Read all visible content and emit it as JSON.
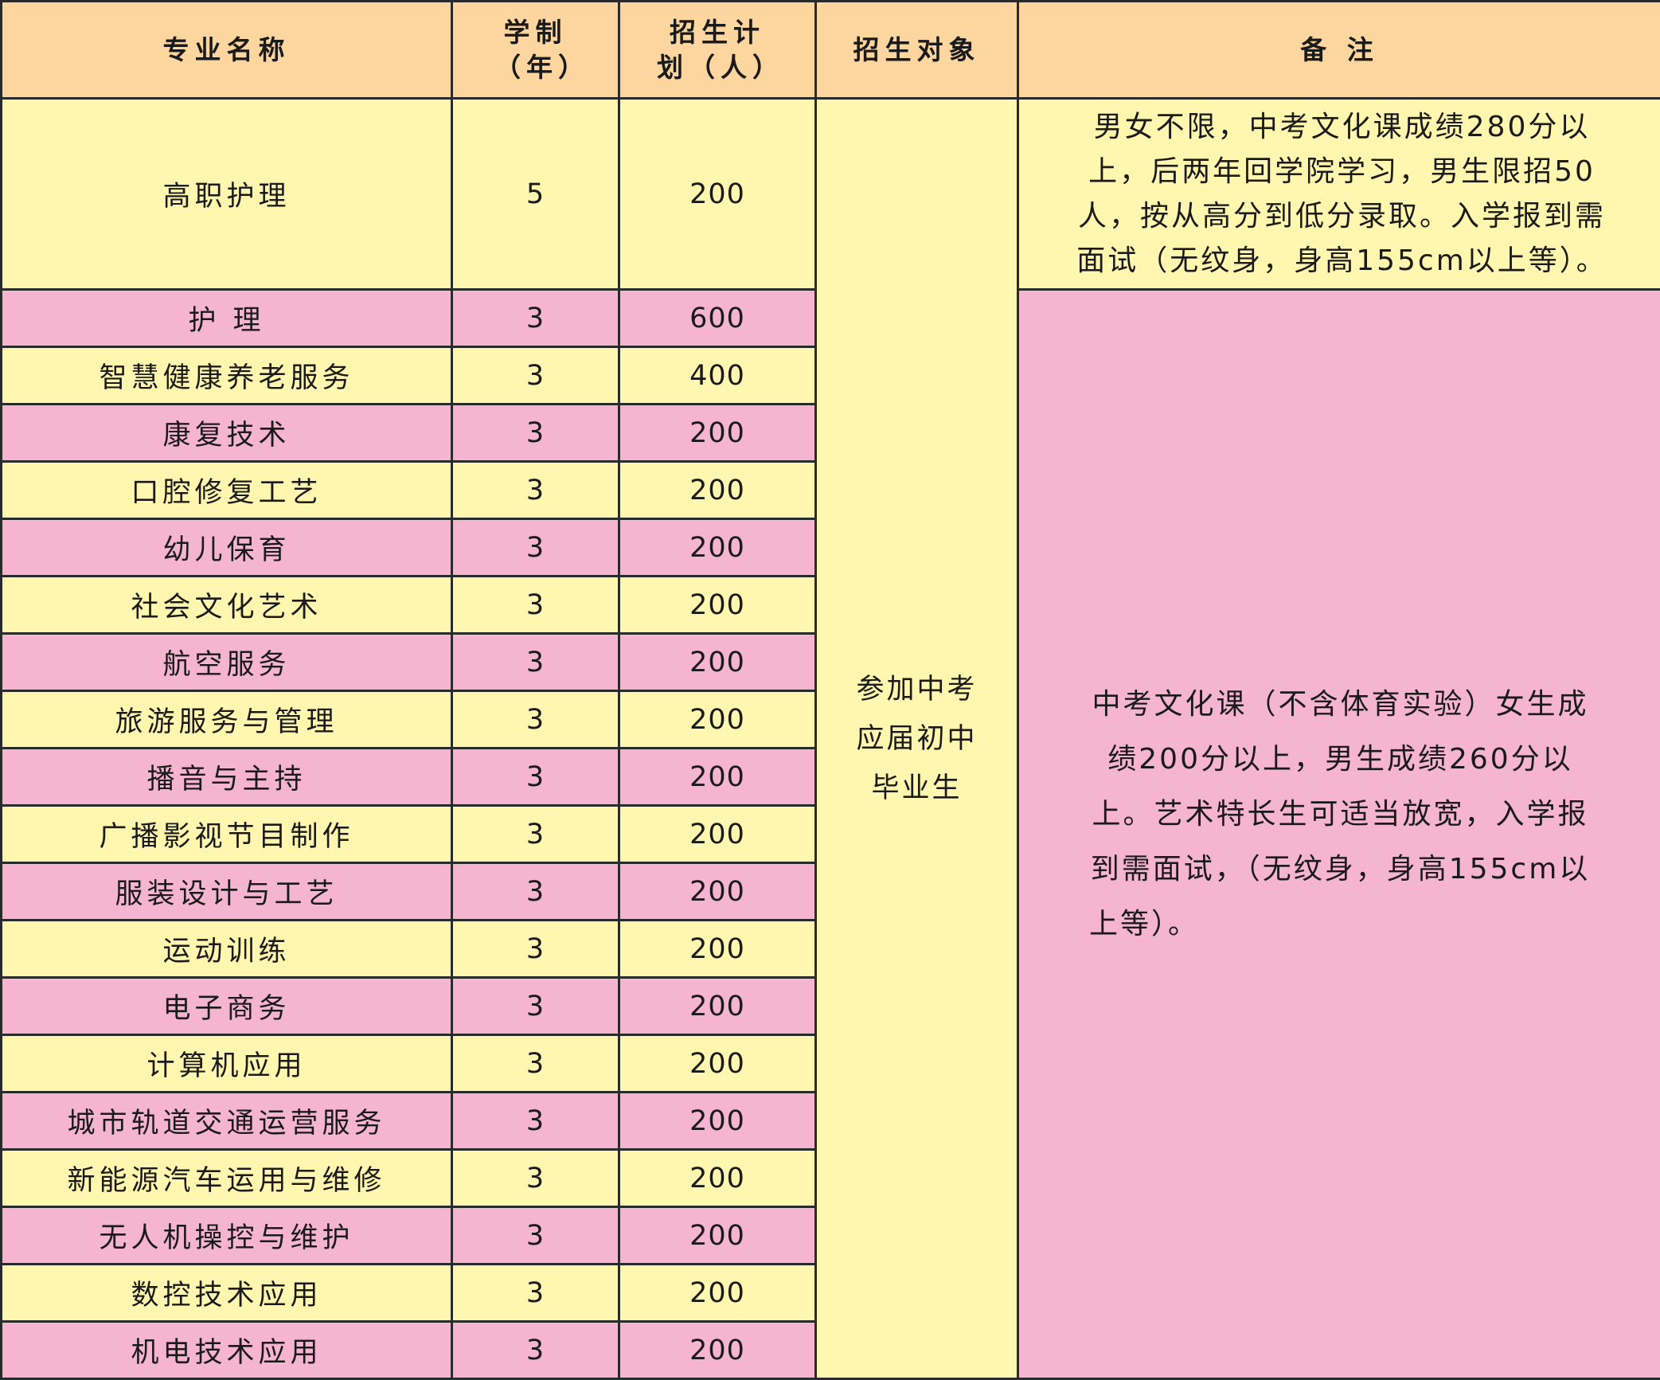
{
  "headers": {
    "name": "专业名称",
    "years": "学制（年）",
    "plan": "招生计划（人）",
    "target": "招生对象",
    "notes": "备 注"
  },
  "target_text": "参加中考应届初中毕业生",
  "notes": {
    "first": "男女不限，中考文化课成绩280分以上，后两年回学院学习，男生限招50人，按从高分到低分录取。入学报到需面试（无纹身，身高155cm以上等）。",
    "rest": "中考文化课（不含体育实验）女生成绩200分以上，男生成绩260分以上。艺术特长生可适当放宽，入学报到需面试，（无纹身，身高155cm以上等）。"
  },
  "rows": [
    {
      "name": "高职护理",
      "years": "5",
      "plan": "200"
    },
    {
      "name": "护 理",
      "years": "3",
      "plan": "600"
    },
    {
      "name": "智慧健康养老服务",
      "years": "3",
      "plan": "400"
    },
    {
      "name": "康复技术",
      "years": "3",
      "plan": "200"
    },
    {
      "name": "口腔修复工艺",
      "years": "3",
      "plan": "200"
    },
    {
      "name": "幼儿保育",
      "years": "3",
      "plan": "200"
    },
    {
      "name": "社会文化艺术",
      "years": "3",
      "plan": "200"
    },
    {
      "name": "航空服务",
      "years": "3",
      "plan": "200"
    },
    {
      "name": "旅游服务与管理",
      "years": "3",
      "plan": "200"
    },
    {
      "name": "播音与主持",
      "years": "3",
      "plan": "200"
    },
    {
      "name": "广播影视节目制作",
      "years": "3",
      "plan": "200"
    },
    {
      "name": "服装设计与工艺",
      "years": "3",
      "plan": "200"
    },
    {
      "name": "运动训练",
      "years": "3",
      "plan": "200"
    },
    {
      "name": "电子商务",
      "years": "3",
      "plan": "200"
    },
    {
      "name": "计算机应用",
      "years": "3",
      "plan": "200"
    },
    {
      "name": "城市轨道交通运营服务",
      "years": "3",
      "plan": "200"
    },
    {
      "name": "新能源汽车运用与维修",
      "years": "3",
      "plan": "200"
    },
    {
      "name": "无人机操控与维护",
      "years": "3",
      "plan": "200"
    },
    {
      "name": "数控技术应用",
      "years": "3",
      "plan": "200"
    },
    {
      "name": "机电技术应用",
      "years": "3",
      "plan": "200"
    }
  ]
}
